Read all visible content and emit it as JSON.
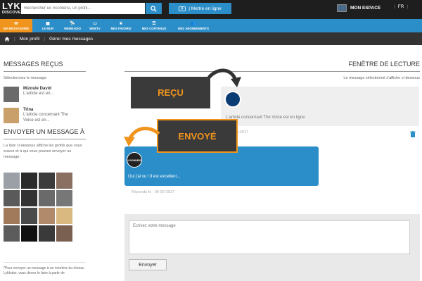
{
  "header": {
    "logo_main": "LYKHUBS",
    "logo_tagline": "DISCOVER & SHARE",
    "search_placeholder": "Rechercher un #contenu, un profil...",
    "post_label": "| Mettre en ligne",
    "space_label": "MON ESPACE",
    "lang": "FR",
    "colors": {
      "topbar": "#1e1e1e",
      "accent_blue": "#2c8ec8",
      "accent_orange": "#f0941e"
    }
  },
  "nav": {
    "tabs": [
      {
        "label": "MA MESSAGERIE",
        "icon": "envelope-icon",
        "active": true
      },
      {
        "label": "LE MUR",
        "icon": "grid-icon",
        "active": false
      },
      {
        "label": "WEBRADIO",
        "icon": "radio-icon",
        "active": false
      },
      {
        "label": "WEBTV",
        "icon": "tv-icon",
        "active": false
      },
      {
        "label": "MES FAVORIS",
        "icon": "star-icon",
        "active": false
      },
      {
        "label": "MES CONTENUS",
        "icon": "list-icon",
        "active": false
      },
      {
        "label": "MES ABONNEMENTS",
        "icon": "users-icon",
        "active": false
      }
    ]
  },
  "breadcrumb": {
    "home_icon": "home-icon",
    "items": [
      "Mon profil",
      "Gérer mes messages"
    ]
  },
  "left": {
    "received_title": "MESSAGES REÇUS",
    "received_hint": "Sélectionnez le message",
    "messages": [
      {
        "name": "Mizoule David",
        "preview": "L'article est en..."
      },
      {
        "name": "Trina",
        "preview": "L'article concernant The Voice est en..."
      }
    ],
    "send_title": "ENVOYER UN MESSAGE À",
    "send_hint": "La liste ci-dessous affiche les profils que vous suivez et à qui vous pouvez envoyer un message.",
    "footnote": "*Pour envoyer un message à un membre du réseau Lykhubs, vous devez le faire à partir de"
  },
  "reading": {
    "title": "FENÊTRE DE LECTURE",
    "hint": "Le message sélectionné s'affiche ci-dessous",
    "received_text": "L'article concernant The Voice est en ligne",
    "received_date": "06-09-2017",
    "sent_text": "Oui j'ai vu ! Il est excellent...",
    "sent_avatar_label": "LYKHUBS",
    "sent_date": "Répondu le : 06-09-2017",
    "composer_placeholder": "Ecrivez votre message",
    "send_button": "Envoyer"
  },
  "callouts": {
    "received": "REÇU",
    "sent": "ENVOYÉ"
  }
}
